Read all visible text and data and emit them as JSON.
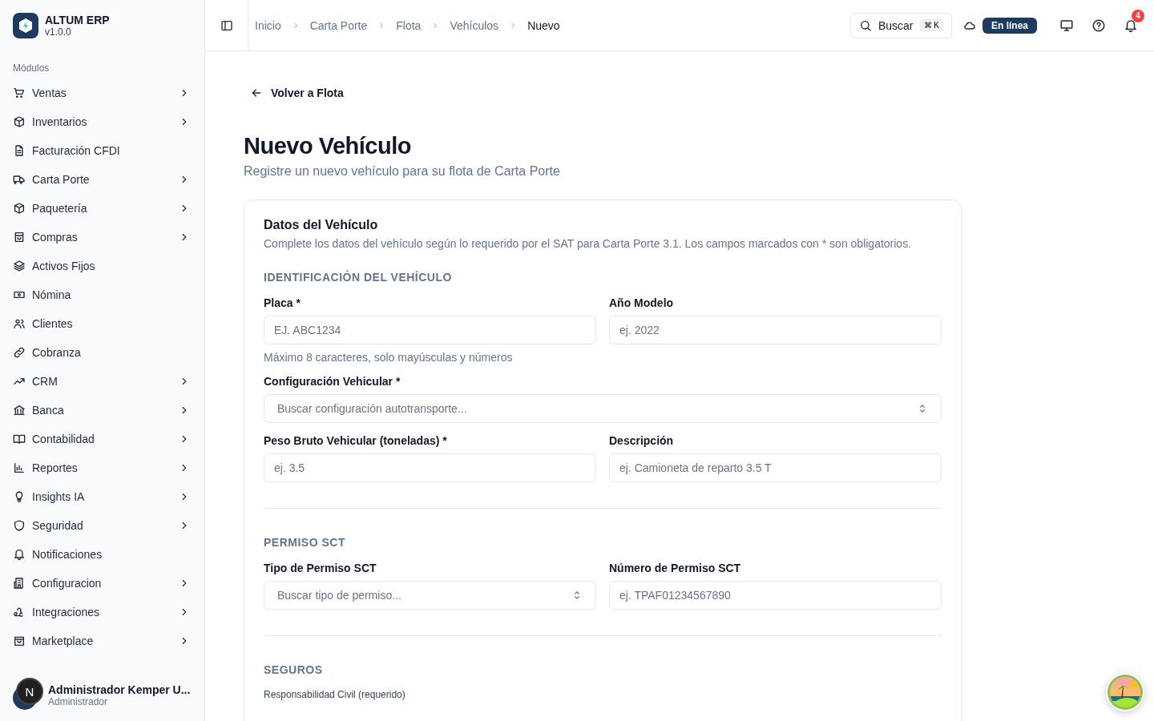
{
  "brand": {
    "name": "ALTUM ERP",
    "version": "v1.0.0"
  },
  "sidebar": {
    "section_label": "Módulos",
    "items": [
      {
        "label": "Ventas",
        "expandable": true
      },
      {
        "label": "Inventarios",
        "expandable": true
      },
      {
        "label": "Facturación CFDI",
        "expandable": false
      },
      {
        "label": "Carta Porte",
        "expandable": true
      },
      {
        "label": "Paquetería",
        "expandable": true
      },
      {
        "label": "Compras",
        "expandable": true
      },
      {
        "label": "Activos Fijos",
        "expandable": false
      },
      {
        "label": "Nómina",
        "expandable": false
      },
      {
        "label": "Clientes",
        "expandable": false
      },
      {
        "label": "Cobranza",
        "expandable": false
      },
      {
        "label": "CRM",
        "expandable": true
      },
      {
        "label": "Banca",
        "expandable": true
      },
      {
        "label": "Contabilidad",
        "expandable": true
      },
      {
        "label": "Reportes",
        "expandable": true
      },
      {
        "label": "Insights IA",
        "expandable": true
      },
      {
        "label": "Seguridad",
        "expandable": true
      },
      {
        "label": "Notificaciones",
        "expandable": false
      },
      {
        "label": "Configuracion",
        "expandable": true
      },
      {
        "label": "Integraciones",
        "expandable": true
      },
      {
        "label": "Marketplace",
        "expandable": true
      }
    ],
    "user": {
      "initial": "N",
      "name": "Administrador Kemper U...",
      "role": "Administrador"
    }
  },
  "breadcrumbs": [
    {
      "label": "Inicio",
      "current": false
    },
    {
      "label": "Carta Porte",
      "current": false
    },
    {
      "label": "Flota",
      "current": false
    },
    {
      "label": "Vehículos",
      "current": false
    },
    {
      "label": "Nuevo",
      "current": true
    }
  ],
  "header": {
    "search_label": "Buscar",
    "shortcut": "⌘ K",
    "status": "En línea",
    "notification_count": "4"
  },
  "back_link": "Volver a Flota",
  "page": {
    "title": "Nuevo Vehículo",
    "subtitle": "Registre un nuevo vehículo para su flota de Carta Porte"
  },
  "card": {
    "title": "Datos del Vehículo",
    "description": "Complete los datos del vehículo según lo requerido por el SAT para Carta Porte 3.1. Los campos marcados con * son obligatorios.",
    "sections": [
      {
        "title": "IDENTIFICACIÓN DEL VEHÍCULO",
        "rows": [
          [
            {
              "label": "Placa *",
              "placeholder": "EJ. ABC1234",
              "kind": "input",
              "hint": "Máximo 8 caracteres, solo mayúsculas y números"
            },
            {
              "label": "Año Modelo",
              "placeholder": "ej. 2022",
              "kind": "input"
            }
          ],
          [
            {
              "label": "Configuración Vehicular *",
              "placeholder": "Buscar configuración autotransporte...",
              "kind": "select"
            }
          ],
          [
            {
              "label": "Peso Bruto Vehicular (toneladas) *",
              "placeholder": "ej. 3.5",
              "kind": "input"
            },
            {
              "label": "Descripción",
              "placeholder": "ej. Camioneta de reparto 3.5 T",
              "kind": "input"
            }
          ]
        ]
      },
      {
        "title": "PERMISO SCT",
        "rows": [
          [
            {
              "label": "Tipo de Permiso SCT",
              "placeholder": "Buscar tipo de permiso...",
              "kind": "select"
            },
            {
              "label": "Número de Permiso SCT",
              "placeholder": "ej. TPAF01234567890",
              "kind": "input"
            }
          ]
        ]
      },
      {
        "title": "SEGUROS",
        "subtitle": "Responsabilidad Civil (requerido)"
      }
    ]
  }
}
